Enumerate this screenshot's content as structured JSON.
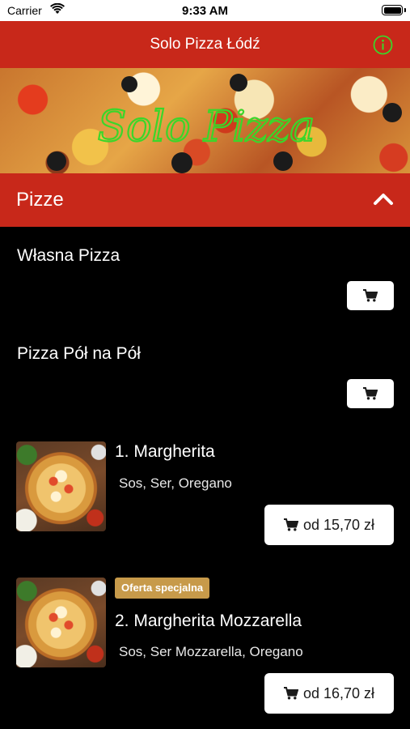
{
  "status_bar": {
    "carrier": "Carrier",
    "time": "9:33 AM"
  },
  "nav": {
    "title": "Solo Pizza Łódź"
  },
  "banner": {
    "logo_text": "Solo Pizza"
  },
  "section": {
    "title": "Pizze"
  },
  "simple_items": [
    {
      "name": "Własna Pizza"
    },
    {
      "name": "Pizza Pół na Pół"
    }
  ],
  "menu_items": [
    {
      "title": "1. Margherita",
      "description": "Sos, Ser, Oregano",
      "price": "od 15,70 zł",
      "badge": ""
    },
    {
      "title": "2. Margherita Mozzarella",
      "description": "Sos, Ser Mozzarella, Oregano",
      "price": "od 16,70 zł",
      "badge": "Oferta specjalna"
    }
  ],
  "colors": {
    "brand_red": "#c8281a",
    "background": "#000000",
    "badge_gold": "#c79a4a",
    "logo_green": "#3bd62a"
  }
}
